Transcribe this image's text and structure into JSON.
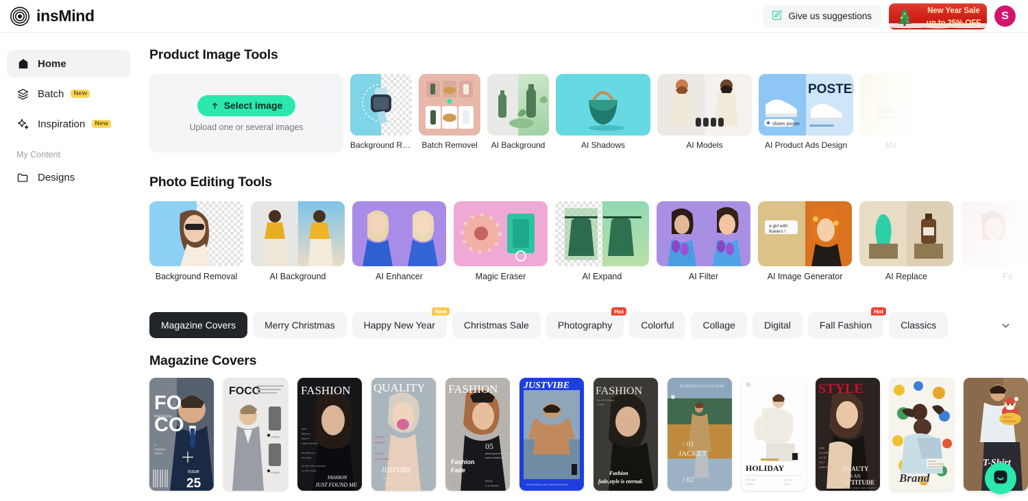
{
  "header": {
    "brand_name": "insMind",
    "logo_icon": "concentric-circles-logo",
    "suggestions_label": "Give us suggestions",
    "suggestions_icon": "edit-note-icon",
    "sale_line1": "New Year Sale",
    "sale_line2": "up to 25% OFF",
    "sale_icon": "christmas-tree-icon",
    "avatar_initial": "S",
    "avatar_color": "#d4146b"
  },
  "sidebar": {
    "items": [
      {
        "label": "Home",
        "icon": "home-icon",
        "badge": "",
        "active": true
      },
      {
        "label": "Batch",
        "icon": "layers-icon",
        "badge": "New",
        "active": false
      },
      {
        "label": "Inspiration",
        "icon": "sparkle-icon",
        "badge": "New",
        "active": false
      }
    ],
    "section_label": "My Content",
    "content_items": [
      {
        "label": "Designs",
        "icon": "folder-icon"
      }
    ]
  },
  "product_tools": {
    "title": "Product Image Tools",
    "upload": {
      "button_label": "Select image",
      "button_icon": "upload-arrow-icon",
      "hint": "Upload one or several images",
      "accent": "#2ae8ae"
    },
    "items": [
      {
        "label": "Background Removal",
        "art": "watch"
      },
      {
        "label": "Batch Removel",
        "art": "batch"
      },
      {
        "label": "AI Background",
        "art": "bottles"
      },
      {
        "label": "AI Shadows",
        "art": "bag"
      },
      {
        "label": "AI Models",
        "art": "models"
      },
      {
        "label": "AI Product Ads Design",
        "art": "poster",
        "poster_text": "POSTER",
        "tag_text": "shoes poster"
      },
      {
        "label": "Ma",
        "art": "faded",
        "partial": true
      }
    ]
  },
  "photo_tools": {
    "title": "Photo Editing Tools",
    "items": [
      {
        "label": "Background Removal",
        "art": "girl-sunglasses"
      },
      {
        "label": "AI Background",
        "art": "yellow-top"
      },
      {
        "label": "AI Enhancer",
        "art": "blonde-blue"
      },
      {
        "label": "Magic Eraser",
        "art": "donut"
      },
      {
        "label": "AI Expand",
        "art": "green-hoodie"
      },
      {
        "label": "AI Filter",
        "art": "girl-tulips"
      },
      {
        "label": "AI Image Generator",
        "art": "orange-hair",
        "prompt_text": "a girl with flowers !"
      },
      {
        "label": "AI Replace",
        "art": "bottle-swap"
      },
      {
        "label": "Fa",
        "art": "faded",
        "partial": true
      }
    ]
  },
  "category_tabs": {
    "items": [
      {
        "label": "Magazine Covers",
        "badge": "",
        "active": true
      },
      {
        "label": "Merry Christmas",
        "badge": "",
        "active": false
      },
      {
        "label": "Happy New Year",
        "badge": "New",
        "active": false
      },
      {
        "label": "Christmas Sale",
        "badge": "",
        "active": false
      },
      {
        "label": "Photography",
        "badge": "Hot",
        "active": false
      },
      {
        "label": "Colorful",
        "badge": "",
        "active": false
      },
      {
        "label": "Collage",
        "badge": "",
        "active": false
      },
      {
        "label": "Digital",
        "badge": "",
        "active": false
      },
      {
        "label": "Fall Fashion",
        "badge": "Hot",
        "active": false
      },
      {
        "label": "Classics",
        "badge": "",
        "active": false
      }
    ],
    "expand_icon": "chevron-down-icon"
  },
  "covers_section": {
    "title": "Magazine Covers",
    "covers": [
      {
        "art": "foco-man",
        "title": "FO CO",
        "sub": "Magazine",
        "footer": "Issue 25"
      },
      {
        "art": "foco-plaid",
        "title": "FOCO",
        "sub": "",
        "footer": ""
      },
      {
        "art": "fashion-dark",
        "title": "FASHION",
        "sub": "",
        "footer": "FASHION JUST FOUND ME"
      },
      {
        "art": "quality-blonde",
        "title": "QUALITY",
        "sub": "",
        "footer": "JUSTVIBE"
      },
      {
        "art": "fashion-fade",
        "title": "FASHION",
        "sub": "Fashion Fade",
        "footer": "05"
      },
      {
        "art": "justvibe-blue",
        "title": "JUSTVIBE",
        "sub": "",
        "footer": ""
      },
      {
        "art": "fashion-eternal",
        "title": "FASHION",
        "sub": "",
        "footer": "Fashion fade,style is eternal."
      },
      {
        "art": "jacket-collection",
        "title": "FASHION COLLECTION",
        "sub": "/ 01 JACKET",
        "footer": "/ 02"
      },
      {
        "art": "holiday-white",
        "title": "HOLIDAY",
        "sub": "",
        "footer": ""
      },
      {
        "art": "style-red",
        "title": "STYLE",
        "sub": "",
        "footer": "BEAUTY IS AN ATTITUDE"
      },
      {
        "art": "brand-dots",
        "title": "Brand",
        "sub": "",
        "footer": ""
      },
      {
        "art": "tshirt-santa",
        "title": "T-Shirt",
        "sub": "Merry Christmas",
        "footer": ""
      }
    ]
  },
  "chat": {
    "icon": "chat-smile-icon",
    "color": "#2ae8ae"
  }
}
